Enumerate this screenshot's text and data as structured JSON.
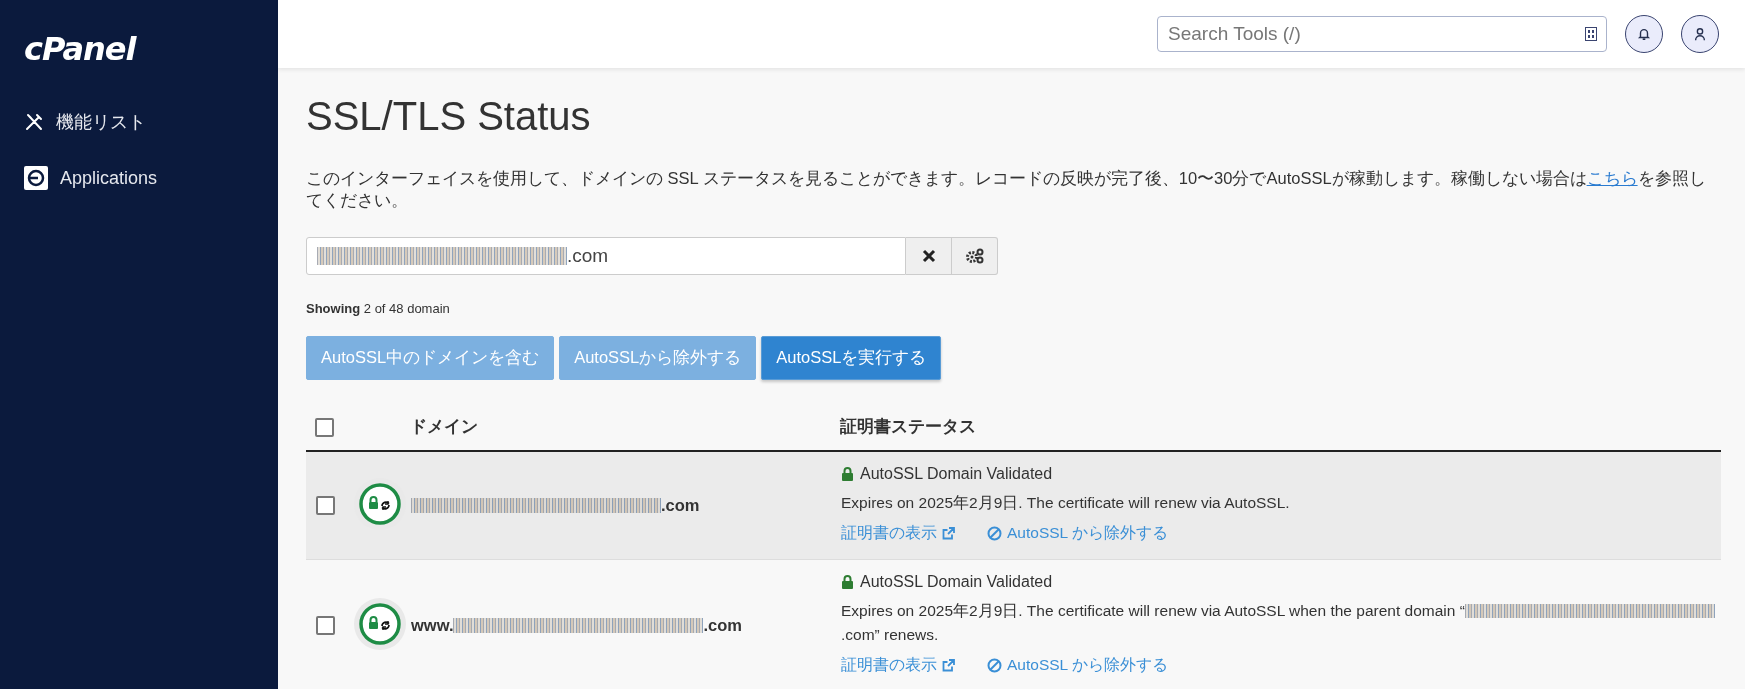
{
  "sidebar": {
    "logo": "cPanel",
    "items": [
      {
        "label": "機能リスト",
        "kind": "tools",
        "selected": false
      },
      {
        "label": "Applications",
        "kind": "apps",
        "selected": false
      }
    ]
  },
  "topbar": {
    "search": {
      "placeholder": "Search Tools (/)"
    }
  },
  "page": {
    "title": "SSL/TLS Status",
    "description": {
      "before": "このインターフェイスを使用して、ドメインの SSL ステータスを見ることができます。レコードの反映が完了後、10〜30分でAutoSSLが稼動します。稼働しない場合は",
      "link": "こちら",
      "after": "を参照してください。"
    },
    "filter": {
      "segments": [
        {
          "kind": "masked"
        },
        {
          "kind": "text",
          "text": ".com"
        }
      ]
    },
    "showing": "**Showing** 2 of 48 domain",
    "actions": [
      {
        "label": "AutoSSL中のドメインを含む",
        "disabled": true
      },
      {
        "label": "AutoSSLから除外する",
        "disabled": true
      },
      {
        "label": "AutoSSLを実行する",
        "disabled": false
      }
    ],
    "table": {
      "select_all": {
        "checked": false
      },
      "columns": [
        "ドメイン",
        "証明書ステータス"
      ],
      "rows": [
        {
          "checked": false,
          "hovered": true,
          "domain": [
            {
              "kind": "masked"
            },
            {
              "kind": "text",
              "text": ".com"
            }
          ],
          "status": "AutoSSL Domain Validated",
          "message": [
            {
              "kind": "text",
              "text": "Expires on 2025年2月9日. The certificate will renew via AutoSSL."
            }
          ],
          "links": [
            {
              "kind": "external",
              "label": "証明書の表示"
            },
            {
              "kind": "exclude",
              "label": "AutoSSL から除外する"
            }
          ]
        },
        {
          "checked": false,
          "hovered": false,
          "domain": [
            {
              "kind": "text",
              "text": "www."
            },
            {
              "kind": "masked"
            },
            {
              "kind": "text",
              "text": ".com"
            }
          ],
          "status": "AutoSSL Domain Validated",
          "message": [
            {
              "kind": "text",
              "text": "Expires on 2025年2月9日. The certificate will renew via AutoSSL when the parent domain “"
            },
            {
              "kind": "masked"
            },
            {
              "kind": "text",
              "text": ".com” renews."
            }
          ],
          "links": [
            {
              "kind": "external",
              "label": "証明書の表示"
            },
            {
              "kind": "exclude",
              "label": "AutoSSL から除外する"
            }
          ]
        }
      ]
    }
  }
}
